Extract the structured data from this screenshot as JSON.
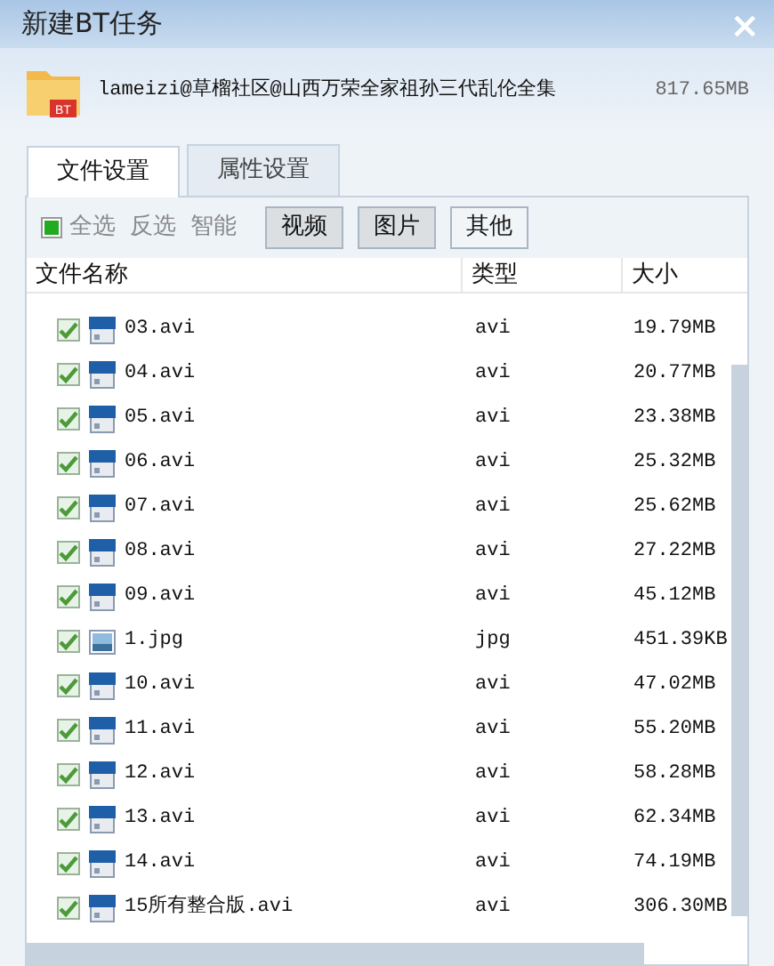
{
  "window": {
    "title": "新建BT任务",
    "close": "×"
  },
  "task": {
    "badge": "BT",
    "name": "lameizi@草榴社区@山西万荣全家祖孙三代乱伦全集",
    "size": "817.65MB"
  },
  "tabs": [
    {
      "label": "文件设置",
      "selected": true
    },
    {
      "label": "属性设置",
      "selected": false
    }
  ],
  "toolbar": {
    "select_all": {
      "label": "全选",
      "checked": true
    },
    "invert": "反选",
    "smart": "智能",
    "filters": [
      {
        "label": "视频",
        "selected": true
      },
      {
        "label": "图片",
        "selected": true
      },
      {
        "label": "其他",
        "selected": false
      }
    ]
  },
  "table": {
    "columns": [
      "文件名称",
      "类型",
      "大小"
    ],
    "rows": [
      {
        "name": "03.avi",
        "type": "avi",
        "size": "19.79MB",
        "kind": "video",
        "checked": true
      },
      {
        "name": "04.avi",
        "type": "avi",
        "size": "20.77MB",
        "kind": "video",
        "checked": true
      },
      {
        "name": "05.avi",
        "type": "avi",
        "size": "23.38MB",
        "kind": "video",
        "checked": true
      },
      {
        "name": "06.avi",
        "type": "avi",
        "size": "25.32MB",
        "kind": "video",
        "checked": true
      },
      {
        "name": "07.avi",
        "type": "avi",
        "size": "25.62MB",
        "kind": "video",
        "checked": true
      },
      {
        "name": "08.avi",
        "type": "avi",
        "size": "27.22MB",
        "kind": "video",
        "checked": true
      },
      {
        "name": "09.avi",
        "type": "avi",
        "size": "45.12MB",
        "kind": "video",
        "checked": true
      },
      {
        "name": "1.jpg",
        "type": "jpg",
        "size": "451.39KB",
        "kind": "image",
        "checked": true
      },
      {
        "name": "10.avi",
        "type": "avi",
        "size": "47.02MB",
        "kind": "video",
        "checked": true
      },
      {
        "name": "11.avi",
        "type": "avi",
        "size": "55.20MB",
        "kind": "video",
        "checked": true
      },
      {
        "name": "12.avi",
        "type": "avi",
        "size": "58.28MB",
        "kind": "video",
        "checked": true
      },
      {
        "name": "13.avi",
        "type": "avi",
        "size": "62.34MB",
        "kind": "video",
        "checked": true
      },
      {
        "name": "14.avi",
        "type": "avi",
        "size": "74.19MB",
        "kind": "video",
        "checked": true
      },
      {
        "name": "15所有整合版.avi",
        "type": "avi",
        "size": "306.30MB",
        "kind": "video",
        "checked": true
      }
    ]
  }
}
